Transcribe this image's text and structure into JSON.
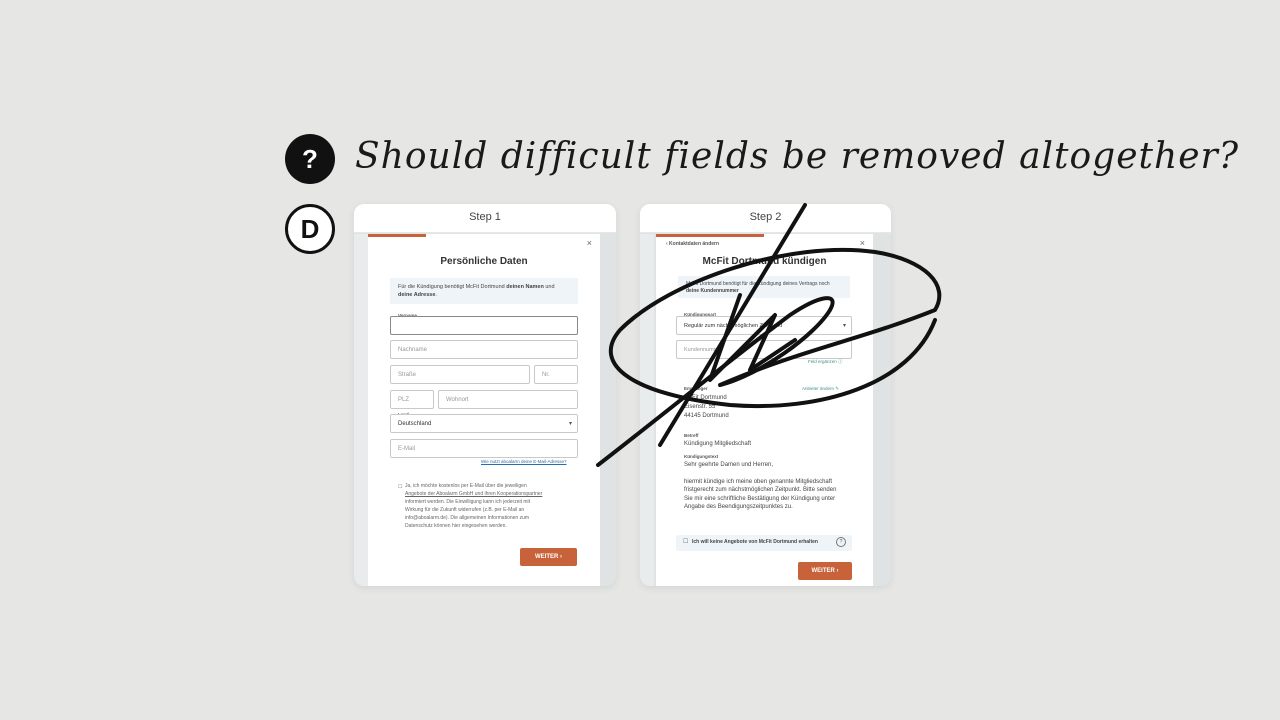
{
  "question": {
    "badge": "?",
    "text": "Should difficult fields be removed altogether?"
  },
  "option": {
    "badge": "D"
  },
  "step1": {
    "label": "Step 1",
    "progress_fraction": 0.25,
    "close_icon": "×",
    "title": "Persönliche Daten",
    "info_prefix": "Für die Kündigung benötigt McFit Dortmund ",
    "info_bold1": "deinen Namen",
    "info_mid": " und ",
    "info_bold2": "deine Adresse",
    "info_suffix": ".",
    "vorname_label": "Vorname",
    "nachname_placeholder": "Nachname",
    "strasse_placeholder": "Straße",
    "nr_placeholder": "Nr.",
    "plz_placeholder": "PLZ",
    "wohnort_placeholder": "Wohnort",
    "land_label": "Land",
    "land_value": "Deutschland",
    "email_placeholder": "E-Mail",
    "email_link": "Wie nutzt aboalarm deine E-Mail-Adresse?",
    "consent_line1": "Ja, ich möchte kostenlos per E-Mail über die jeweiligen",
    "consent_line2": "Angebote der Aboalarm GmbH und ihren Kooperationspartner",
    "consent_line3": "informiert werden. Die Einwilligung kann ich jederzeit mit",
    "consent_line4": "Wirkung für die Zukunft widerrufen (z.B. per E-Mail an",
    "consent_line5": "info@aboalarm.de). Die allgemeinen Informationen zum",
    "consent_line6": "Datenschutz können hier eingesehen werden.",
    "button": "WEITER ›"
  },
  "step2": {
    "label": "Step 2",
    "progress_fraction": 0.5,
    "back_link": "‹  Kontaktdaten ändern",
    "close_icon": "×",
    "title": "McFit Dortmund kündigen",
    "info_line1": "McFit Dortmund benötigt für die Kündigung deines Vertrags noch",
    "info_line2": "deine Kundennummer",
    "kuendigungsart_label": "Kündigungsart",
    "kuendigungsart_value": "Regulär zum nächstmöglichen Zeitpunkt",
    "kundennummer_placeholder": "Kundennummer",
    "feld_ergaenzen": "Feld ergänzen ⓘ",
    "empfaenger_label": "Empfänger",
    "anbieter_aendern": "Anbieter ändern ✎",
    "addr1": "McFit Dortmund",
    "addr2": "Eisenstr. 55",
    "addr3": "44145 Dortmund",
    "betreff_label": "Betreff",
    "betreff_value": "Kündigung Mitgliedschaft",
    "text_label": "Kündigungstext",
    "greeting": "Sehr geehrte Damen und Herren,",
    "body1": "hiermit kündige ich meine oben genannte Mitgliedschaft",
    "body2": "fristgerecht zum nächstmöglichen Zeitpunkt. Bitte senden",
    "body3": "Sie mir eine schriftliche Bestätigung der Kündigung unter",
    "body4": "Angabe des Beendigungszeitpunktes zu.",
    "checkbox_label": "Ich will keine Angebote von McFit Dortmund erhalten",
    "help_icon": "?",
    "button": "WEITER ›"
  },
  "colors": {
    "accent": "#c8623a",
    "link": "#2a6da8",
    "teal": "#3f8f8a"
  }
}
